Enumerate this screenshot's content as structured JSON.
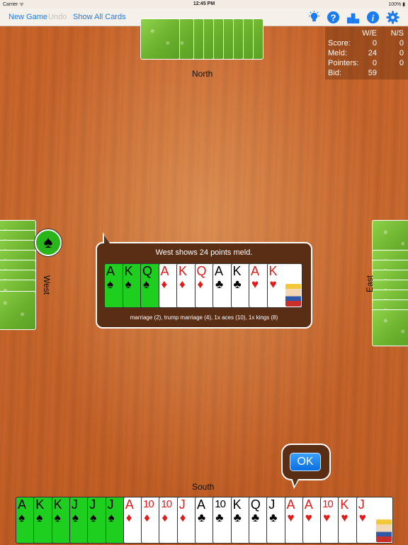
{
  "status_bar": {
    "carrier": "Carrier ᯤ",
    "time": "12:45 PM",
    "battery": "100% ▮"
  },
  "toolbar": {
    "new_game": "New Game",
    "undo": "Undo",
    "show_all_cards": "Show All Cards",
    "icons": [
      "hint-bulb-icon",
      "help-icon",
      "scores-podium-icon",
      "info-icon",
      "settings-gear-icon"
    ],
    "accent_color": "#1a7cf0"
  },
  "scoreboard": {
    "col_we": "W/E",
    "col_ns": "N/S",
    "rows": [
      {
        "label": "Score:",
        "we": "0",
        "ns": "0"
      },
      {
        "label": "Meld:",
        "we": "24",
        "ns": "0"
      },
      {
        "label": "Pointers:",
        "we": "0",
        "ns": "0"
      },
      {
        "label": "Bid:",
        "we": "59",
        "ns": ""
      }
    ]
  },
  "seats": {
    "north": "North",
    "west": "West",
    "east": "East",
    "south": "South"
  },
  "trump_suit": "♠",
  "meld_dialog": {
    "title": "West shows 24 points meld.",
    "description": "marriage (2), trump marriage (4), 1x aces (10), 1x kings (8)",
    "cards": [
      {
        "rank": "A",
        "suit": "♠",
        "color": "black",
        "highlight": true
      },
      {
        "rank": "K",
        "suit": "♠",
        "color": "black",
        "highlight": true
      },
      {
        "rank": "Q",
        "suit": "♠",
        "color": "black",
        "highlight": true
      },
      {
        "rank": "A",
        "suit": "♦",
        "color": "red",
        "highlight": false
      },
      {
        "rank": "K",
        "suit": "♦",
        "color": "red",
        "highlight": false
      },
      {
        "rank": "Q",
        "suit": "♦",
        "color": "red",
        "highlight": false
      },
      {
        "rank": "A",
        "suit": "♣",
        "color": "black",
        "highlight": false
      },
      {
        "rank": "K",
        "suit": "♣",
        "color": "black",
        "highlight": false
      },
      {
        "rank": "A",
        "suit": "♥",
        "color": "red",
        "highlight": false
      },
      {
        "rank": "K",
        "suit": "♥",
        "color": "red",
        "highlight": false
      }
    ]
  },
  "ok_button": "OK",
  "south_hand": [
    {
      "rank": "A",
      "suit": "♠",
      "color": "black",
      "highlight": true
    },
    {
      "rank": "K",
      "suit": "♠",
      "color": "black",
      "highlight": true
    },
    {
      "rank": "K",
      "suit": "♠",
      "color": "black",
      "highlight": true
    },
    {
      "rank": "J",
      "suit": "♠",
      "color": "black",
      "highlight": true
    },
    {
      "rank": "J",
      "suit": "♠",
      "color": "black",
      "highlight": true
    },
    {
      "rank": "J",
      "suit": "♠",
      "color": "black",
      "highlight": true
    },
    {
      "rank": "A",
      "suit": "♦",
      "color": "red",
      "highlight": false
    },
    {
      "rank": "10",
      "suit": "♦",
      "color": "red",
      "highlight": false
    },
    {
      "rank": "10",
      "suit": "♦",
      "color": "red",
      "highlight": false
    },
    {
      "rank": "J",
      "suit": "♦",
      "color": "red",
      "highlight": false
    },
    {
      "rank": "A",
      "suit": "♣",
      "color": "black",
      "highlight": false
    },
    {
      "rank": "10",
      "suit": "♣",
      "color": "black",
      "highlight": false
    },
    {
      "rank": "K",
      "suit": "♣",
      "color": "black",
      "highlight": false
    },
    {
      "rank": "Q",
      "suit": "♣",
      "color": "black",
      "highlight": false
    },
    {
      "rank": "J",
      "suit": "♣",
      "color": "black",
      "highlight": false
    },
    {
      "rank": "A",
      "suit": "♥",
      "color": "red",
      "highlight": false
    },
    {
      "rank": "A",
      "suit": "♥",
      "color": "red",
      "highlight": false
    },
    {
      "rank": "10",
      "suit": "♥",
      "color": "red",
      "highlight": false
    },
    {
      "rank": "K",
      "suit": "♥",
      "color": "red",
      "highlight": false
    },
    {
      "rank": "J",
      "suit": "♥",
      "color": "red",
      "highlight": false
    }
  ]
}
